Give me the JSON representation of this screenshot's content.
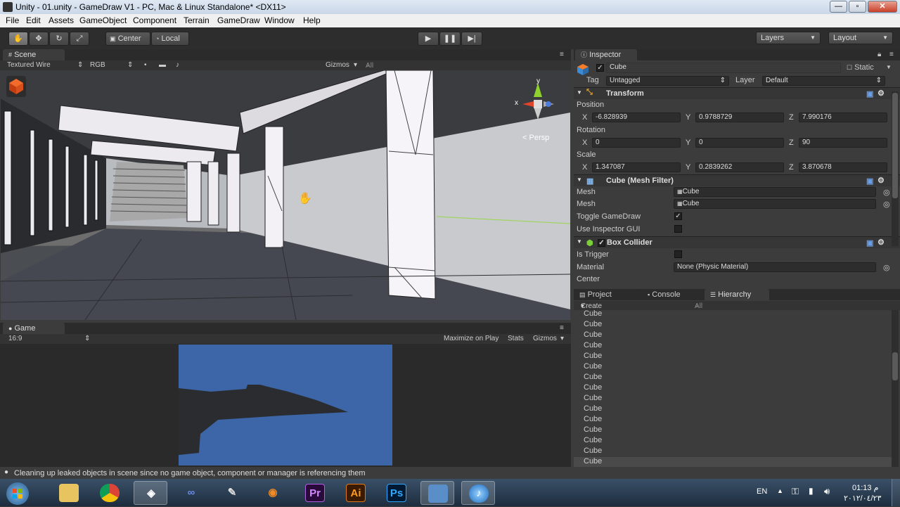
{
  "window": {
    "title": "Unity - 01.unity - GameDraw V1 - PC, Mac & Linux Standalone* <DX11>",
    "min": "—",
    "max": "▫",
    "close": "✕"
  },
  "menu": [
    "File",
    "Edit",
    "Assets",
    "GameObject",
    "Component",
    "Terrain",
    "GameDraw",
    "Window",
    "Help"
  ],
  "toolbar": {
    "pivot": "Center",
    "space": "Local",
    "layers": "Layers",
    "layout": "Layout"
  },
  "scene": {
    "tab": "Scene",
    "render_mode": "Textured Wire",
    "color_mode": "RGB",
    "gizmos": "Gizmos",
    "search_placeholder": "All",
    "persp": "Persp",
    "axis_y": "y",
    "axis_x": "x"
  },
  "game": {
    "tab": "Game",
    "aspect": "16:9",
    "maximize": "Maximize on Play",
    "stats": "Stats",
    "gizmos": "Gizmos"
  },
  "inspector": {
    "tab": "Inspector",
    "object_name": "Cube",
    "static_label": "Static",
    "tag_label": "Tag",
    "tag_value": "Untagged",
    "layer_label": "Layer",
    "layer_value": "Default",
    "transform": {
      "title": "Transform",
      "position_label": "Position",
      "rotation_label": "Rotation",
      "scale_label": "Scale",
      "position": {
        "x": "-6.828939",
        "y": "0.9788729",
        "z": "7.990176"
      },
      "rotation": {
        "x": "0",
        "y": "0",
        "z": "90"
      },
      "scale": {
        "x": "1.347087",
        "y": "0.2839262",
        "z": "3.870678"
      }
    },
    "mesh_filter": {
      "title": "Cube (Mesh Filter)",
      "mesh1_label": "Mesh",
      "mesh1_value": "Cube",
      "mesh2_label": "Mesh",
      "mesh2_value": "Cube",
      "toggle_label": "Toggle GameDraw",
      "toggle_checked": "✓",
      "use_gui_label": "Use Inspector GUI"
    },
    "box_collider": {
      "title": "Box Collider",
      "is_trigger_label": "Is Trigger",
      "material_label": "Material",
      "material_value": "None (Physic Material)",
      "center_label": "Center"
    }
  },
  "bottom_tabs": {
    "project": "Project",
    "console": "Console",
    "hierarchy": "Hierarchy"
  },
  "hierarchy": {
    "create": "Create",
    "search_placeholder": "All",
    "items": [
      "Cube",
      "Cube",
      "Cube",
      "Cube",
      "Cube",
      "Cube",
      "Cube",
      "Cube",
      "Cube",
      "Cube",
      "Cube",
      "Cube",
      "Cube",
      "Cube",
      "Cube"
    ]
  },
  "status": {
    "message": "Cleaning up leaked objects in scene since no game object, component or manager is referencing them"
  },
  "taskbar": {
    "lang": "EN",
    "time": "01:13 م",
    "date": "٢٠١٢/٠٤/٢٣",
    "apps": [
      {
        "icon": "windows-start-icon"
      },
      {
        "icon": "folder-icon"
      },
      {
        "icon": "chrome-icon"
      },
      {
        "icon": "unity-icon"
      },
      {
        "icon": "infinity-icon"
      },
      {
        "icon": "feather-icon"
      },
      {
        "icon": "blender-icon"
      },
      {
        "icon": "premiere-icon",
        "label": "Pr"
      },
      {
        "icon": "illustrator-icon",
        "label": "Ai"
      },
      {
        "icon": "photoshop-icon",
        "label": "Ps"
      },
      {
        "icon": "screen-icon"
      },
      {
        "icon": "itunes-icon"
      }
    ]
  }
}
